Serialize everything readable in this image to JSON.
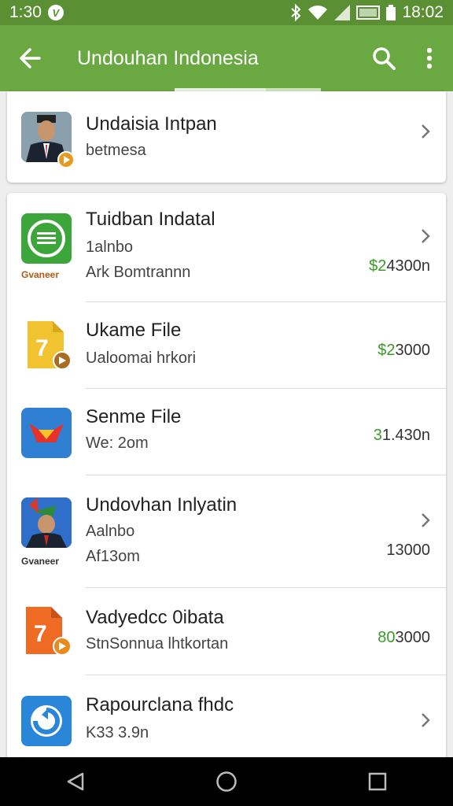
{
  "status_bar": {
    "time_left": "1:30",
    "time_right": "18:02"
  },
  "app_bar": {
    "title": "Undouhan Indonesia"
  },
  "featured": {
    "title": "Undaisia Intpan",
    "subtitle": "betmesa"
  },
  "apps": [
    {
      "title": "Tuidban Indatal",
      "line2": "1alnbo",
      "line3": "Ark Bomtrannn",
      "caption": "Gvaneer",
      "price_green": "$2",
      "price_rest": "4300n",
      "chevron": true
    },
    {
      "title": "Ukame File",
      "line2": "Ualoomai hrkori",
      "line3": "",
      "caption": "",
      "price_green": "$2",
      "price_rest": "3000",
      "chevron": false
    },
    {
      "title": "Senme File",
      "line2": "We: 2om",
      "line3": "",
      "caption": "",
      "price_green": "3",
      "price_rest": "1.430n",
      "chevron": false
    },
    {
      "title": "Undovhan Inlyatin",
      "line2": "Aalnbo",
      "line3": "Af13om",
      "caption": "Gvaneer",
      "price_green": "",
      "price_rest": "13000",
      "chevron": true
    },
    {
      "title": "Vadyedcc 0ibata",
      "line2": "StnSonnua lhtkortan",
      "line3": "",
      "caption": "",
      "price_green": "80",
      "price_rest": "3000",
      "chevron": false
    },
    {
      "title": "Rapourclana fhdc",
      "line2": "K33 3.9n",
      "line3": "",
      "caption": "",
      "price_green": "",
      "price_rest": "",
      "chevron": true
    }
  ],
  "icons": {
    "app1": "green-list-icon",
    "app2": "yellow-file-icon",
    "app3": "red-envelope-icon",
    "app4": "portrait-icon",
    "app5": "orange-file-icon",
    "app6": "blue-swirl-icon"
  },
  "colors": {
    "primary": "#6aa842",
    "status": "#5a8f34",
    "price_green": "#3c9a2a"
  }
}
